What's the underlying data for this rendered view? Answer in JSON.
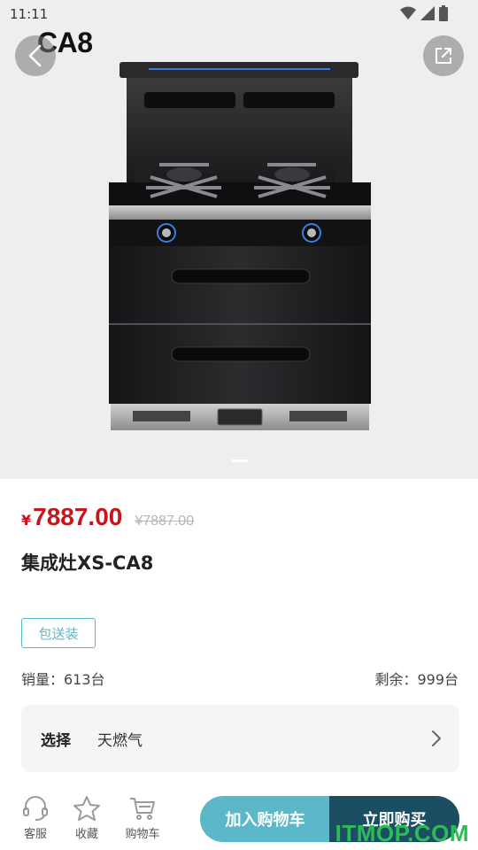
{
  "status_bar": {
    "time": "11:11"
  },
  "hero": {
    "title": "CA8",
    "carousel_index": 1
  },
  "product": {
    "currency": "¥",
    "price": "7887.00",
    "original_price": "¥7887.00",
    "name": "集成灶XS-CA8",
    "tag": "包送装",
    "sales": "销量：613台",
    "stock": "剩余：999台"
  },
  "spec": {
    "label": "选择",
    "value": "天燃气"
  },
  "bottom_nav": {
    "service": "客服",
    "favorite": "收藏",
    "cart": "购物车",
    "add_to_cart": "加入购物车",
    "buy_now": "立即购买"
  },
  "watermark": "ITMOP.COM",
  "colors": {
    "price": "#c4161c",
    "accent": "#5bb8c9",
    "buy": "#1b4e63"
  }
}
